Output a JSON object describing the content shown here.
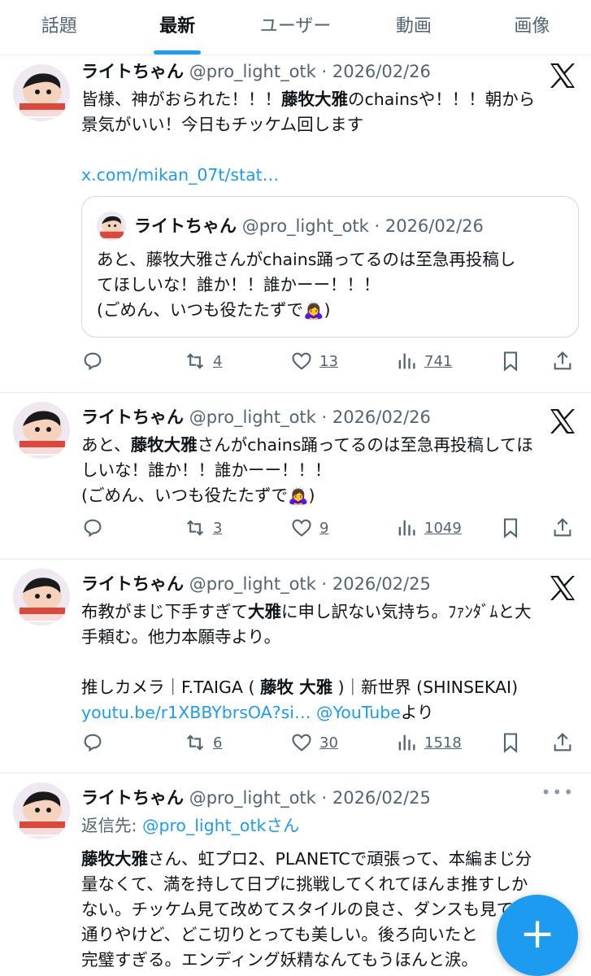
{
  "tabs": [
    {
      "label": "話題"
    },
    {
      "label": "最新",
      "active": true
    },
    {
      "label": "ユーザー"
    },
    {
      "label": "動画"
    },
    {
      "label": "画像"
    }
  ],
  "tweets": [
    {
      "name": "ライトちゃん",
      "meta": "@pro_light_otk · 2026/02/26",
      "text_parts": [
        "皆様、神がおられた！！！",
        "藤牧大雅",
        "のchainsや！！！朝から\n景気がいい！今日もチッケム回します"
      ],
      "link": "x.com/mikan_07t/stat…",
      "quote": {
        "name": "ライトちゃん",
        "meta": "@pro_light_otk · 2026/02/26",
        "text": "あと、藤牧大雅さんがchains踊ってるのは至急再投稿し\nてほしいな！誰か！！誰かーー！！！\n(ごめん、いつも役たたずで🙇‍♀️)"
      },
      "replies": "",
      "retweets": "4",
      "likes": "13",
      "views": "741"
    },
    {
      "name": "ライトちゃん",
      "meta": "@pro_light_otk · 2026/02/26",
      "text_parts": [
        "あと、",
        "藤牧大雅",
        "さんがchains踊ってるのは至急再投稿してほ\nしいな！誰か！！誰かーー！！！\n(ごめん、いつも役たたずで🙇‍♀️)"
      ],
      "replies": "",
      "retweets": "3",
      "likes": "9",
      "views": "1049"
    },
    {
      "name": "ライトちゃん",
      "meta": "@pro_light_otk · 2026/02/25",
      "text_parts": [
        "布教がまじ下手すぎて",
        "大雅",
        "に申し訳ない気持ち。ﾌｧﾝﾀﾞﾑと大\n手頼む。他力本願寺より。\n\n推しカメラ｜F.TAIGA ( ",
        "藤牧 大雅",
        " )｜新世界 (SHINSEKAI)"
      ],
      "link": "youtu.be/r1XBBYbrsOA?si…",
      "mention": "@YouTube",
      "suffix": "より",
      "replies": "",
      "retweets": "6",
      "likes": "30",
      "views": "1518"
    },
    {
      "name": "ライトちゃん",
      "meta": "@pro_light_otk · 2026/02/25",
      "reply_label": "返信先: ",
      "reply_handle": "@pro_light_otkさん",
      "text_parts": [
        "藤牧大雅",
        "さん、虹プロ2、PLANETCで頑張って、本編まじ分\n量なくて、満を持して日プに挑戦してくれてほんま推すしか\nない。チッケム見て改めてスタイルの良さ、ダンスも見ての\n通りやけど、どこ切りとっても美しい。後ろ向いたと\n完璧すぎる。エンディング妖精なんてもうほんと涙。"
      ]
    }
  ],
  "fab": {
    "label": "+"
  },
  "colors": {
    "accent": "#1d9bf0",
    "secondary_text": "#536471",
    "border": "#cfd9de"
  },
  "icons": [
    "reply-icon",
    "retweet-icon",
    "like-icon",
    "views-icon",
    "bookmark-icon",
    "share-icon",
    "x-logo-icon",
    "plus-icon",
    "more-icon"
  ]
}
